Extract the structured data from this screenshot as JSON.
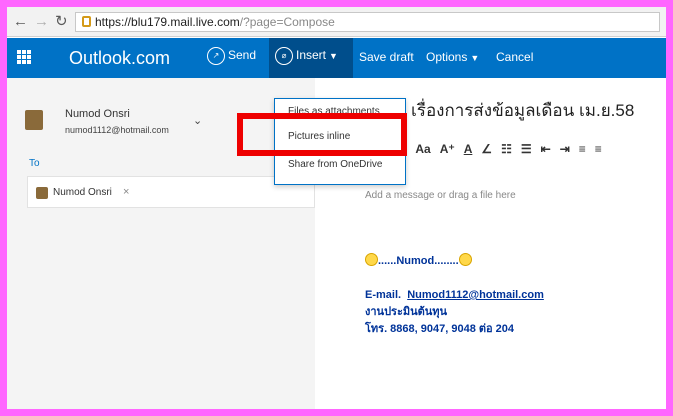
{
  "browser": {
    "url_host": "https://blu179.mail.live.com",
    "url_rest": "/?page=Compose"
  },
  "header": {
    "brand": "Outlook.com",
    "send_icon": "send-icon",
    "send_label": "Send",
    "insert_icon": "attach-icon",
    "insert_label": "Insert",
    "save_draft_label": "Save draft",
    "options_label": "Options",
    "cancel_label": "Cancel",
    "bg_color": "#0072c6"
  },
  "account": {
    "name": "Numod Onsri",
    "email": "numod1112@hotmail.com"
  },
  "recipients": {
    "label": "To",
    "chips": [
      {
        "name": "Numod Onsri"
      }
    ]
  },
  "insert_menu": {
    "items": [
      {
        "label": "Files as attachments"
      },
      {
        "label": "Pictures inline"
      },
      {
        "label": "Share from OneDrive"
      }
    ],
    "highlighted_index": 1,
    "highlight_color": "#ee0000"
  },
  "compose": {
    "subject": "เรื่องการส่งข้อมูลเดือน เม.ย.58",
    "body_placeholder": "Add a message or drag a file here",
    "signature": {
      "name_line": "......Numod........",
      "email_prefix": "E-mail.",
      "email": "Numod1112@hotmail.com",
      "dept": "งานประมินต้นทุน",
      "phone": "โทร. 8868, 9047, 9048 ต่อ 204"
    }
  }
}
